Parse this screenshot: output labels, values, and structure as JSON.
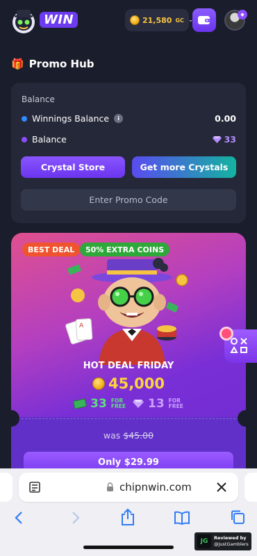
{
  "header": {
    "logo_text": "WIN",
    "balance": "21,580",
    "balance_unit": "GC"
  },
  "promo_hub": {
    "title": "Promo Hub",
    "panel_label": "Balance",
    "winnings_label": "Winnings Balance",
    "winnings_value": "0.00",
    "balance_label": "Balance",
    "crystals_value": "33",
    "crystal_store_button": "Crystal Store",
    "get_more_button": "Get more Crystals",
    "promo_code_button": "Enter Promo Code"
  },
  "deal": {
    "tag_best": "BEST DEAL",
    "tag_extra": "50% EXTRA COINS",
    "title": "HOT DEAL FRIDAY",
    "coins": "45,000",
    "free_cash": "33",
    "free_gems": "13",
    "free_label_1": "FOR",
    "free_label_2": "FREE",
    "was_label": "was",
    "was_price": "$45.00",
    "buy_button": "Only $29.99"
  },
  "browser": {
    "url": "chipnwin.com"
  },
  "watermark": {
    "line1": "Reviewed by",
    "line2": "@JustGamblers",
    "logo": "JG"
  },
  "colors": {
    "background": "#1a1d2b",
    "accent_purple": "#6d3bf0",
    "gold": "#f6c443",
    "crystal": "#b48cff"
  },
  "icons": [
    "logo-mascot",
    "coin-icon",
    "chevron-down-icon",
    "wallet-icon",
    "avatar",
    "crystal-icon",
    "gift-icon",
    "info-icon",
    "cash-icon",
    "reader-icon",
    "lock-icon",
    "close-icon",
    "back-icon",
    "forward-icon",
    "share-icon",
    "bookmarks-icon",
    "tabs-icon"
  ]
}
